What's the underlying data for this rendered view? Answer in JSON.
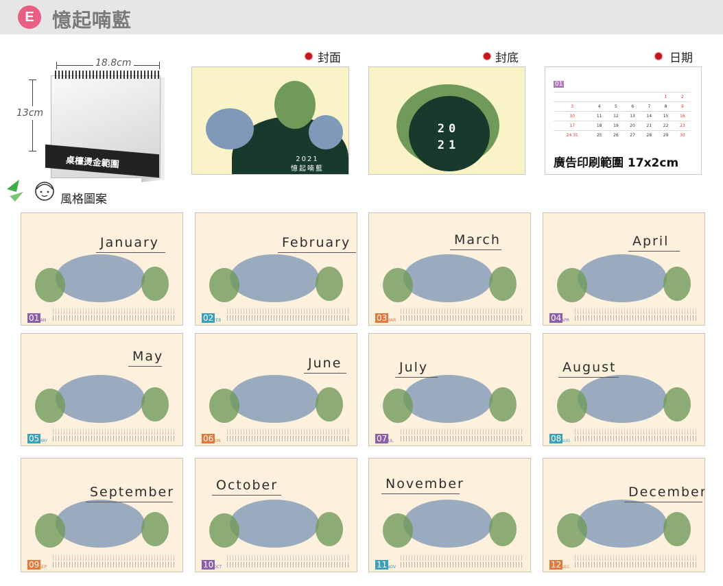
{
  "header": {
    "badge": "E",
    "title": "憶起喃藍"
  },
  "product": {
    "width_label": "18.8cm",
    "height_label": "13cm",
    "stamp_area": "桌檯燙金範圍"
  },
  "style_label": "風格圖案",
  "views": [
    {
      "label": "封面",
      "type": "cover",
      "cover_text": "2021\n憶起喃藍"
    },
    {
      "label": "封底",
      "type": "back",
      "year_line1": "20",
      "year_line2": "21"
    },
    {
      "label": "日期",
      "type": "dates",
      "month_tag": "01",
      "ad_text": "廣告印刷範圍 17x2cm"
    }
  ],
  "months": [
    {
      "num": "01",
      "abbr": "JAN",
      "name": "January",
      "color": "#8b5fa8"
    },
    {
      "num": "02",
      "abbr": "FEB",
      "name": "February",
      "color": "#3aa0b8"
    },
    {
      "num": "03",
      "abbr": "MAR",
      "name": "March",
      "color": "#e07a3c"
    },
    {
      "num": "04",
      "abbr": "APR",
      "name": "April",
      "color": "#8b5fa8"
    },
    {
      "num": "05",
      "abbr": "MAY",
      "name": "May",
      "color": "#3aa0b8"
    },
    {
      "num": "06",
      "abbr": "JUN",
      "name": "June",
      "color": "#e07a3c"
    },
    {
      "num": "07",
      "abbr": "JUL",
      "name": "July",
      "color": "#8b5fa8"
    },
    {
      "num": "08",
      "abbr": "AUG",
      "name": "August",
      "color": "#3aa0b8"
    },
    {
      "num": "09",
      "abbr": "SEP",
      "name": "September",
      "color": "#e07a3c"
    },
    {
      "num": "10",
      "abbr": "OCT",
      "name": "October",
      "color": "#8b5fa8"
    },
    {
      "num": "11",
      "abbr": "NOV",
      "name": "November",
      "color": "#3aa0b8"
    },
    {
      "num": "12",
      "abbr": "DEC",
      "name": "December",
      "color": "#e07a3c"
    }
  ]
}
